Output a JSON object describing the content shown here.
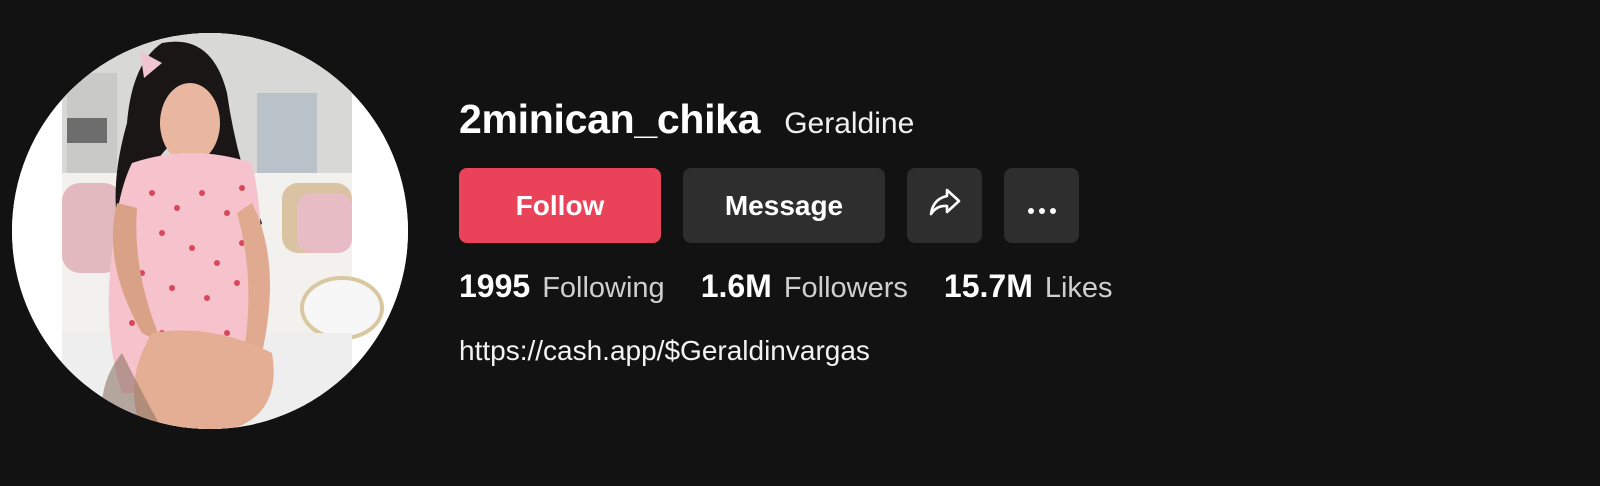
{
  "profile": {
    "username": "2minican_chika",
    "nickname": "Geraldine",
    "bio_link": "https://cash.app/$Geraldinvargas"
  },
  "actions": {
    "follow_label": "Follow",
    "message_label": "Message",
    "share_icon": "share-icon",
    "more_icon": "more-icon"
  },
  "stats": [
    {
      "value": "1995",
      "label": "Following"
    },
    {
      "value": "1.6M",
      "label": "Followers"
    },
    {
      "value": "15.7M",
      "label": "Likes"
    }
  ],
  "colors": {
    "background": "#121212",
    "follow_button": "#ea4359",
    "secondary_button": "#2e2e2e"
  }
}
